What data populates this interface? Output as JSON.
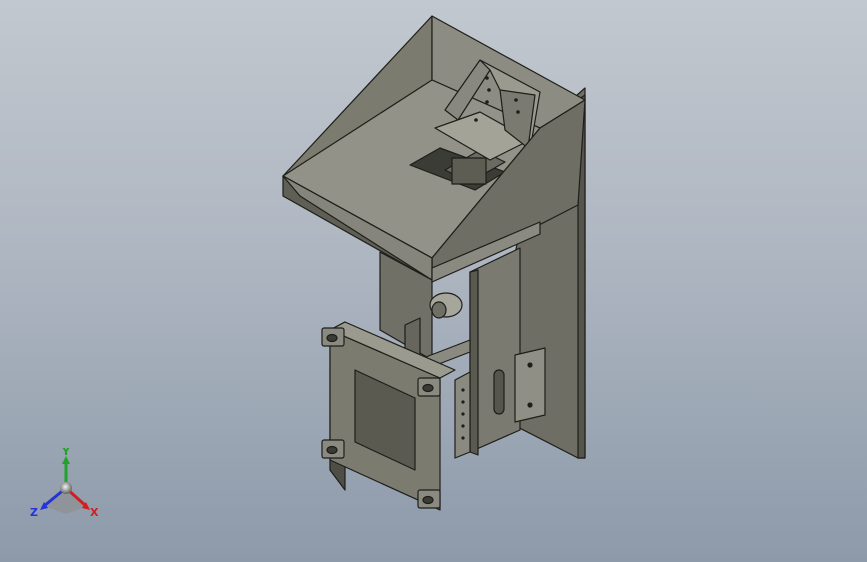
{
  "viewport": {
    "background_top": "#c2c8cf",
    "background_bottom": "#8d9aaa"
  },
  "model": {
    "body_color": "#77776c",
    "light_face_color": "#9a9a8f",
    "dark_face_color": "#55554c",
    "edge_color": "#1e1e1a"
  },
  "triad": {
    "y_label": "Y",
    "x_label": "X",
    "z_label": "Z",
    "y_color": "#1fa32a",
    "x_color": "#d21e1e",
    "z_color": "#2434d6"
  }
}
